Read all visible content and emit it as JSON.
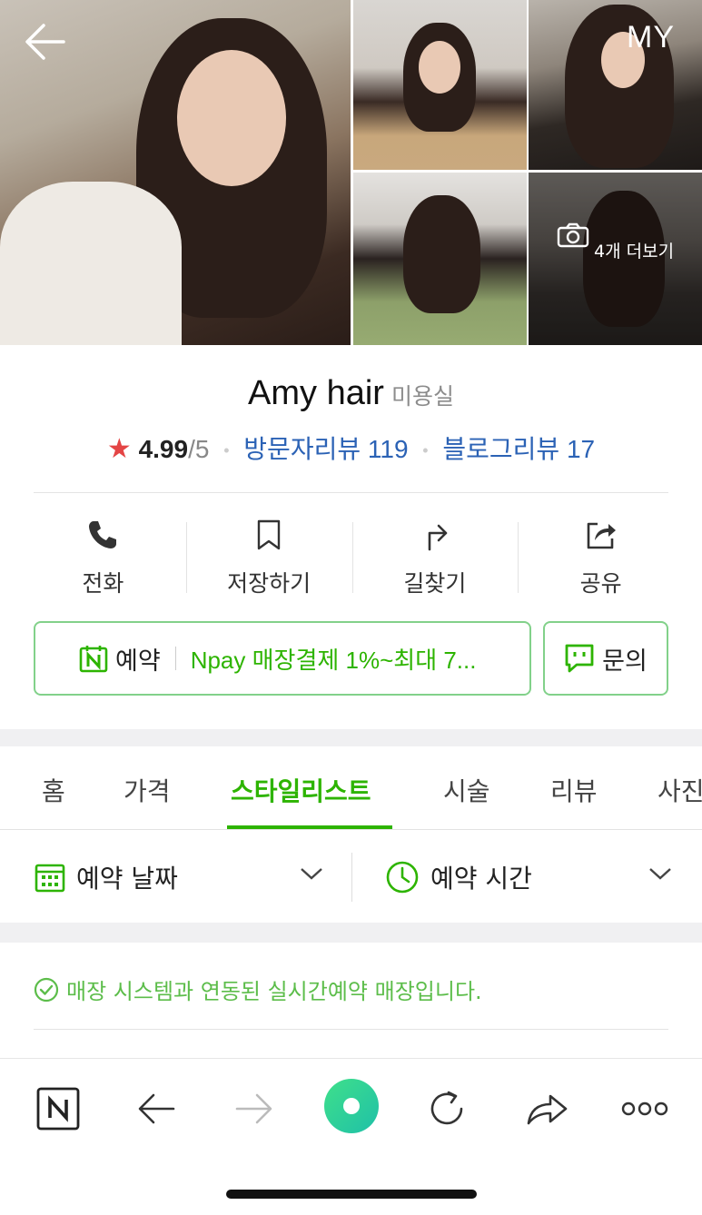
{
  "header": {
    "back_label": "←",
    "my_label": "MY"
  },
  "photos": {
    "more_label": "4개 더보기"
  },
  "place": {
    "name": "Amy hair",
    "category": "미용실",
    "rating_star": "★",
    "rating": "4.99",
    "rating_max": "/5",
    "visitor_reviews": "방문자리뷰 119",
    "blog_reviews": "블로그리뷰 17"
  },
  "actions": {
    "call": "전화",
    "save": "저장하기",
    "directions": "길찾기",
    "share": "공유"
  },
  "booking": {
    "book_label": "예약",
    "npay_label": "Npay 매장결제 1%~최대 7...",
    "inquiry_label": "문의"
  },
  "tabs": [
    {
      "label": "홈"
    },
    {
      "label": "가격"
    },
    {
      "label": "스타일리스트",
      "active": true
    },
    {
      "label": "시술"
    },
    {
      "label": "리뷰"
    },
    {
      "label": "사진"
    }
  ],
  "filters": {
    "date_label": "예약 날짜",
    "time_label": "예약 시간"
  },
  "notice": "매장 시스템과 연동된 실시간예약 매장입니다.",
  "colors": {
    "accent": "#2db400",
    "link": "#2b62b5",
    "star": "#e44545"
  },
  "browser_bar": {
    "icons": [
      "naver-home-icon",
      "back-arrow-icon",
      "forward-arrow-icon",
      "green-dot-icon",
      "refresh-icon",
      "share-arrow-icon",
      "more-icon"
    ]
  }
}
